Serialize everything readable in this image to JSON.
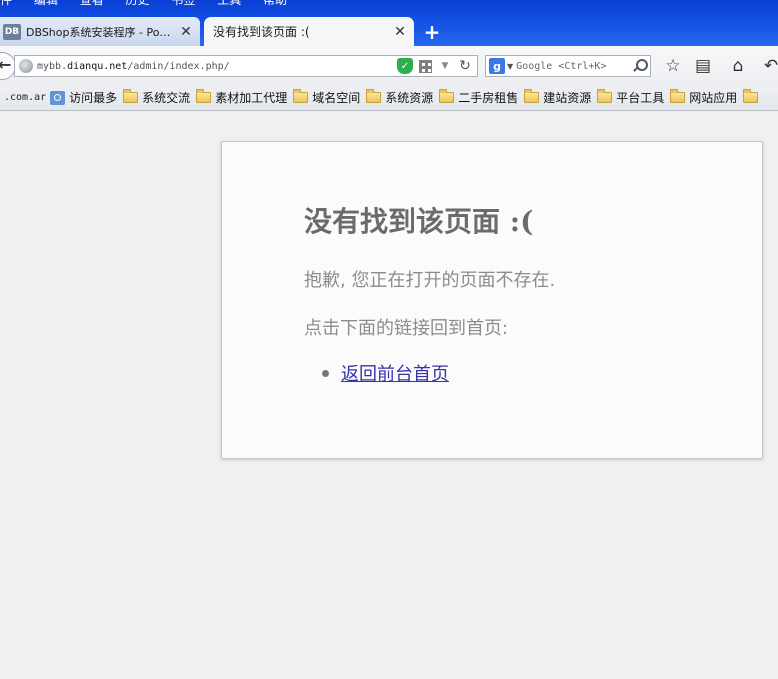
{
  "browser": {
    "menu_remnants": [
      "件",
      "编辑",
      "查看",
      "历史",
      "书签",
      "工具",
      "帮助"
    ],
    "tabs": [
      {
        "favicon_text": "DB",
        "title": "DBShop系统安装程序 - Po…",
        "active": false
      },
      {
        "title": "没有找到该页面 :(",
        "active": true
      }
    ],
    "new_tab_label": "+",
    "url": {
      "prefix": "mybb.",
      "domain": "dianqu.net",
      "path": "/admin/index.php/"
    },
    "search": {
      "engine_letter": "g",
      "placeholder": "Google <Ctrl+K>"
    },
    "bookmarks": {
      "clipped_first": ".com.ar",
      "items": [
        {
          "label": "访问最多",
          "icon": "most-visited-icon"
        },
        {
          "label": "系统交流",
          "icon": "folder-icon"
        },
        {
          "label": "素材加工代理",
          "icon": "folder-icon"
        },
        {
          "label": "域名空间",
          "icon": "folder-icon"
        },
        {
          "label": "系统资源",
          "icon": "folder-icon"
        },
        {
          "label": "二手房租售",
          "icon": "folder-icon"
        },
        {
          "label": "建站资源",
          "icon": "folder-icon"
        },
        {
          "label": "平台工具",
          "icon": "folder-icon"
        },
        {
          "label": "网站应用",
          "icon": "folder-icon"
        }
      ]
    }
  },
  "page": {
    "title": "没有找到该页面 :(",
    "message": "抱歉, 您正在打开的页面不存在.",
    "hint": "点击下面的链接回到首页:",
    "links": [
      {
        "label": "返回前台首页"
      }
    ]
  },
  "colors": {
    "titlebar_blue": "#1556e6",
    "page_background": "#f0f0f0",
    "card_background": "#fbfbfb",
    "title_text": "#6b6b6b",
    "body_text": "#8c8c8c",
    "link": "#3333aa"
  }
}
